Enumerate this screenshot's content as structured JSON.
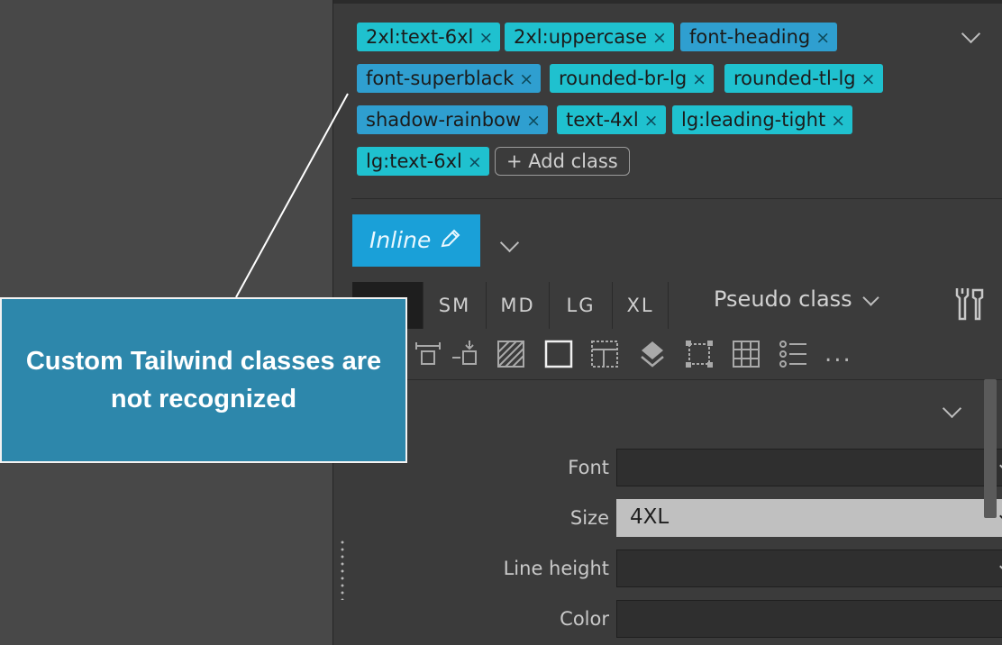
{
  "class_tags": [
    {
      "label": "2xl:text-6xl",
      "color": "cyan"
    },
    {
      "label": "2xl:uppercase",
      "color": "cyan"
    },
    {
      "label": "font-heading",
      "color": "blue"
    },
    {
      "label": "font-superblack",
      "color": "blue"
    },
    {
      "label": "rounded-br-lg",
      "color": "cyan"
    },
    {
      "label": "rounded-tl-lg",
      "color": "cyan"
    },
    {
      "label": "shadow-rainbow",
      "color": "blue"
    },
    {
      "label": "text-4xl",
      "color": "cyan"
    },
    {
      "label": "lg:leading-tight",
      "color": "cyan"
    },
    {
      "label": "lg:text-6xl",
      "color": "cyan"
    }
  ],
  "tag_remove_glyph": "×",
  "add_class_label": "+ Add class",
  "inline_button_label": "Inline",
  "breakpoints": [
    "",
    "SM",
    "MD",
    "LG",
    "XL"
  ],
  "pseudo_class_label": "Pseudo class",
  "more_label": "...",
  "properties": {
    "font": {
      "label": "Font",
      "value": ""
    },
    "size": {
      "label": "Size",
      "value": "4XL"
    },
    "line_height": {
      "label": "Line height",
      "value": ""
    },
    "color": {
      "label": "Color",
      "value": ""
    }
  },
  "callout_text": "Custom Tailwind classes are not recognized",
  "colors": {
    "tag_cyan": "#1fc1cf",
    "tag_blue": "#2f9fd0",
    "accent": "#1aa0d8",
    "callout_bg": "#2d87ab"
  },
  "icons": [
    "chevron-down-icon",
    "pencil-icon",
    "tools-icon",
    "spacing-icon",
    "position-icon",
    "background-icon",
    "border-icon",
    "layout-icon",
    "layers-icon",
    "bounds-icon",
    "grid-icon",
    "list-icon"
  ]
}
